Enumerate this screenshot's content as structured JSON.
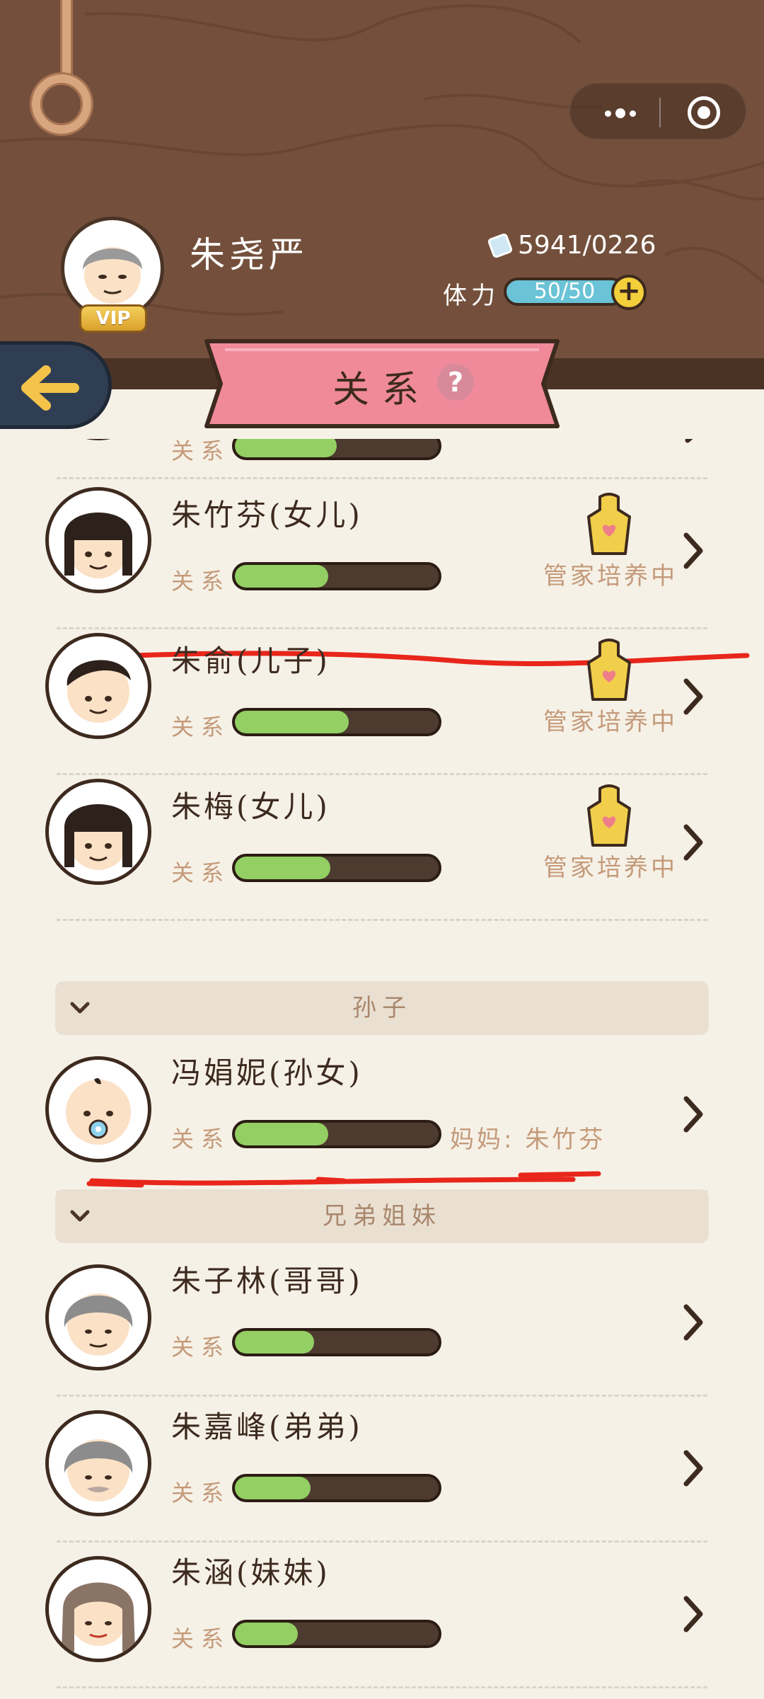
{
  "player": {
    "name": "朱尧严",
    "vip": "VIP",
    "coins": "5941/0226",
    "stamina_label": "体力",
    "stamina": "50/50"
  },
  "topbar": {
    "menu_icon": "more-dots-icon",
    "close_icon": "target-icon"
  },
  "banner": {
    "title": "关系",
    "help": "?"
  },
  "rows": [
    {
      "name": "",
      "relation_label": "关系",
      "fill": 0.5,
      "status": ""
    },
    {
      "name": "朱竹芬(女儿)",
      "relation_label": "关系",
      "fill": 0.46,
      "status": "管家培养中"
    },
    {
      "name": "朱俞(儿子)",
      "relation_label": "关系",
      "fill": 0.56,
      "status": "管家培养中"
    },
    {
      "name": "朱梅(女儿)",
      "relation_label": "关系",
      "fill": 0.47,
      "status": "管家培养中"
    },
    {
      "name": "冯娟妮(孙女)",
      "relation_label": "关系",
      "fill": 0.46,
      "extra": "妈妈: 朱竹芬"
    },
    {
      "name": "朱子林(哥哥)",
      "relation_label": "关系",
      "fill": 0.39
    },
    {
      "name": "朱嘉峰(弟弟)",
      "relation_label": "关系",
      "fill": 0.37
    },
    {
      "name": "朱涵(妹妹)",
      "relation_label": "关系",
      "fill": 0.31
    }
  ],
  "sections": {
    "grandchildren": "孙子",
    "siblings": "兄弟姐妹"
  },
  "colors": {
    "wood": "#74503c",
    "bar_fill": "#93cf63",
    "bar_bg": "#4e3b30",
    "banner": "#f08a9b",
    "annotation": "#e8261b"
  }
}
